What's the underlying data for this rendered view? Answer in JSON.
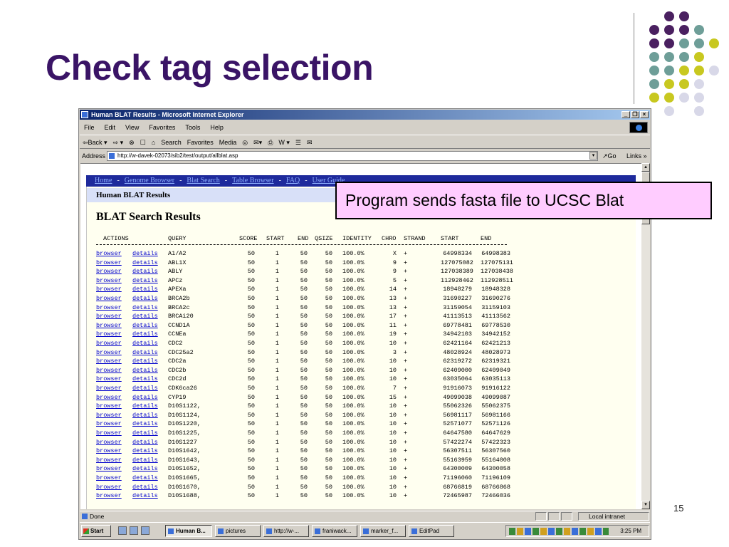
{
  "slide": {
    "title": "Check tag selection",
    "page_number": "15",
    "callout": "Program sends fasta file to UCSC Blat",
    "colors": {
      "title": "#3a1466",
      "dot_purple": "#4a2060",
      "dot_teal": "#6e9e98",
      "dot_yellow": "#c8c820",
      "dot_light": "#d8d8e8"
    }
  },
  "browser": {
    "window_title": "Human BLAT Results - Microsoft Internet Explorer",
    "window_buttons": [
      "_",
      "×"
    ],
    "menu": [
      "File",
      "Edit",
      "View",
      "Favorites",
      "Tools",
      "Help"
    ],
    "toolbar": [
      "⇦Back ▾",
      "⇨ ▾",
      "⊗",
      "☐",
      "⌂",
      "Search",
      "Favorites",
      "Media",
      "◎",
      "✉▾",
      "⎙",
      "W ▾",
      "☰",
      "✉"
    ],
    "address_label": "Address",
    "address": "http://w-davek-02073/sib2/test/output/allblat.asp",
    "go_label": "↗Go",
    "links_label": "Links »",
    "status": "Done",
    "status_zone": "Local intranet"
  },
  "page": {
    "nav": [
      "Home",
      "Genome Browser",
      "Blat Search",
      "Table Browser",
      "FAQ",
      "User Guide"
    ],
    "section_header": "Human BLAT Results",
    "results_title": "BLAT Search Results",
    "columns": [
      "ACTIONS",
      "QUERY",
      "SCORE",
      "START",
      "END",
      "QSIZE",
      "IDENTITY",
      "CHRO",
      "STRAND",
      "START",
      "END"
    ],
    "action_links": [
      "browser",
      "details"
    ],
    "rows": [
      {
        "query": "A1/A2",
        "score": "50",
        "start": "1",
        "end": "50",
        "qsize": "50",
        "identity": "100.0%",
        "chro": "X",
        "strand": "+",
        "gstart": "64998334",
        "gend": "64998383"
      },
      {
        "query": "ABL1X",
        "score": "50",
        "start": "1",
        "end": "50",
        "qsize": "50",
        "identity": "100.0%",
        "chro": "9",
        "strand": "+",
        "gstart": "127075082",
        "gend": "127075131"
      },
      {
        "query": "ABLY",
        "score": "50",
        "start": "1",
        "end": "50",
        "qsize": "50",
        "identity": "100.0%",
        "chro": "9",
        "strand": "+",
        "gstart": "127038389",
        "gend": "127038438"
      },
      {
        "query": "APCz",
        "score": "50",
        "start": "1",
        "end": "50",
        "qsize": "50",
        "identity": "100.0%",
        "chro": "5",
        "strand": "+",
        "gstart": "112928462",
        "gend": "112928511"
      },
      {
        "query": "APEXa",
        "score": "50",
        "start": "1",
        "end": "50",
        "qsize": "50",
        "identity": "100.0%",
        "chro": "14",
        "strand": "+",
        "gstart": "18948279",
        "gend": "18948328"
      },
      {
        "query": "BRCA2b",
        "score": "50",
        "start": "1",
        "end": "50",
        "qsize": "50",
        "identity": "100.0%",
        "chro": "13",
        "strand": "+",
        "gstart": "31690227",
        "gend": "31690276"
      },
      {
        "query": "BRCA2c",
        "score": "50",
        "start": "1",
        "end": "50",
        "qsize": "50",
        "identity": "100.0%",
        "chro": "13",
        "strand": "+",
        "gstart": "31159054",
        "gend": "31159103"
      },
      {
        "query": "BRCAi20",
        "score": "50",
        "start": "1",
        "end": "50",
        "qsize": "50",
        "identity": "100.0%",
        "chro": "17",
        "strand": "+",
        "gstart": "41113513",
        "gend": "41113562"
      },
      {
        "query": "CCND1A",
        "score": "50",
        "start": "1",
        "end": "50",
        "qsize": "50",
        "identity": "100.0%",
        "chro": "11",
        "strand": "+",
        "gstart": "69778481",
        "gend": "69778530"
      },
      {
        "query": "CCNEa",
        "score": "50",
        "start": "1",
        "end": "50",
        "qsize": "50",
        "identity": "100.0%",
        "chro": "19",
        "strand": "+",
        "gstart": "34942103",
        "gend": "34942152"
      },
      {
        "query": "CDC2",
        "score": "50",
        "start": "1",
        "end": "50",
        "qsize": "50",
        "identity": "100.0%",
        "chro": "10",
        "strand": "+",
        "gstart": "62421164",
        "gend": "62421213"
      },
      {
        "query": "CDC25a2",
        "score": "50",
        "start": "1",
        "end": "50",
        "qsize": "50",
        "identity": "100.0%",
        "chro": "3",
        "strand": "+",
        "gstart": "48028924",
        "gend": "48028973"
      },
      {
        "query": "CDC2a",
        "score": "50",
        "start": "1",
        "end": "50",
        "qsize": "50",
        "identity": "100.0%",
        "chro": "10",
        "strand": "+",
        "gstart": "62319272",
        "gend": "62319321"
      },
      {
        "query": "CDC2b",
        "score": "50",
        "start": "1",
        "end": "50",
        "qsize": "50",
        "identity": "100.0%",
        "chro": "10",
        "strand": "+",
        "gstart": "62409000",
        "gend": "62409049"
      },
      {
        "query": "CDC2d",
        "score": "50",
        "start": "1",
        "end": "50",
        "qsize": "50",
        "identity": "100.0%",
        "chro": "10",
        "strand": "+",
        "gstart": "63035064",
        "gend": "63035113"
      },
      {
        "query": "CDK6ca26",
        "score": "50",
        "start": "1",
        "end": "50",
        "qsize": "50",
        "identity": "100.0%",
        "chro": "7",
        "strand": "+",
        "gstart": "91916073",
        "gend": "91916122"
      },
      {
        "query": "CYP19",
        "score": "50",
        "start": "1",
        "end": "50",
        "qsize": "50",
        "identity": "100.0%",
        "chro": "15",
        "strand": "+",
        "gstart": "49099038",
        "gend": "49099087"
      },
      {
        "query": "D10S1122,",
        "score": "50",
        "start": "1",
        "end": "50",
        "qsize": "50",
        "identity": "100.0%",
        "chro": "10",
        "strand": "+",
        "gstart": "55062326",
        "gend": "55062375"
      },
      {
        "query": "D10S1124,",
        "score": "50",
        "start": "1",
        "end": "50",
        "qsize": "50",
        "identity": "100.0%",
        "chro": "10",
        "strand": "+",
        "gstart": "56981117",
        "gend": "56981166"
      },
      {
        "query": "D10S1220,",
        "score": "50",
        "start": "1",
        "end": "50",
        "qsize": "50",
        "identity": "100.0%",
        "chro": "10",
        "strand": "+",
        "gstart": "52571077",
        "gend": "52571126"
      },
      {
        "query": "D10S1225,",
        "score": "50",
        "start": "1",
        "end": "50",
        "qsize": "50",
        "identity": "100.0%",
        "chro": "10",
        "strand": "+",
        "gstart": "64647580",
        "gend": "64647629"
      },
      {
        "query": "D10S1227",
        "score": "50",
        "start": "1",
        "end": "50",
        "qsize": "50",
        "identity": "100.0%",
        "chro": "10",
        "strand": "+",
        "gstart": "57422274",
        "gend": "57422323"
      },
      {
        "query": "D10S1642,",
        "score": "50",
        "start": "1",
        "end": "50",
        "qsize": "50",
        "identity": "100.0%",
        "chro": "10",
        "strand": "+",
        "gstart": "56307511",
        "gend": "56307560"
      },
      {
        "query": "D10S1643,",
        "score": "50",
        "start": "1",
        "end": "50",
        "qsize": "50",
        "identity": "100.0%",
        "chro": "10",
        "strand": "+",
        "gstart": "55163959",
        "gend": "55164008"
      },
      {
        "query": "D10S1652,",
        "score": "50",
        "start": "1",
        "end": "50",
        "qsize": "50",
        "identity": "100.0%",
        "chro": "10",
        "strand": "+",
        "gstart": "64300009",
        "gend": "64300058"
      },
      {
        "query": "D10S1665,",
        "score": "50",
        "start": "1",
        "end": "50",
        "qsize": "50",
        "identity": "100.0%",
        "chro": "10",
        "strand": "+",
        "gstart": "71196060",
        "gend": "71196109"
      },
      {
        "query": "D10S1670,",
        "score": "50",
        "start": "1",
        "end": "50",
        "qsize": "50",
        "identity": "100.0%",
        "chro": "10",
        "strand": "+",
        "gstart": "68766819",
        "gend": "68766868"
      },
      {
        "query": "D10S1688,",
        "score": "50",
        "start": "1",
        "end": "50",
        "qsize": "50",
        "identity": "100.0%",
        "chro": "10",
        "strand": "+",
        "gstart": "72465987",
        "gend": "72466036"
      }
    ]
  },
  "taskbar": {
    "start": "Start",
    "tasks": [
      "Human B...",
      "pictures",
      "http://w-...",
      "franiwack...",
      "marker_f...",
      "EditPad"
    ],
    "clock": "3:25 PM"
  }
}
